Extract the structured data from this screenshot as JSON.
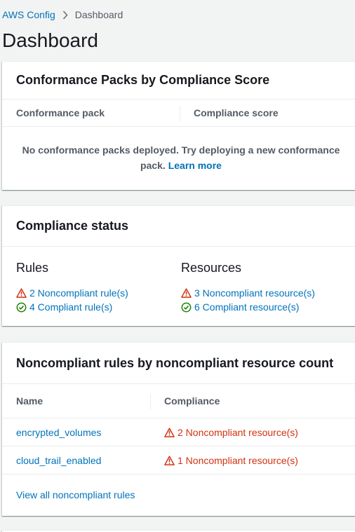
{
  "breadcrumb": {
    "root": "AWS Config",
    "current": "Dashboard"
  },
  "page_title": "Dashboard",
  "conformance": {
    "title": "Conformance Packs by Compliance Score",
    "col_pack": "Conformance pack",
    "col_score": "Compliance score",
    "empty_text": "No conformance packs deployed. Try deploying a new conformance pack.",
    "learn_more": "Learn more"
  },
  "compliance_status": {
    "title": "Compliance status",
    "rules": {
      "heading": "Rules",
      "noncompliant": "2 Noncompliant rule(s)",
      "compliant": "4 Compliant rule(s)"
    },
    "resources": {
      "heading": "Resources",
      "noncompliant": "3 Noncompliant resource(s)",
      "compliant": "6 Compliant resource(s)"
    }
  },
  "noncompliant_rules": {
    "title": "Noncompliant rules by noncompliant resource count",
    "col_name": "Name",
    "col_compliance": "Compliance",
    "rows": [
      {
        "name": "encrypted_volumes",
        "compliance": "2 Noncompliant resource(s)"
      },
      {
        "name": "cloud_trail_enabled",
        "compliance": "1 Noncompliant resource(s)"
      }
    ],
    "view_all": "View all noncompliant rules"
  },
  "colors": {
    "link": "#0073bb",
    "error": "#d13212",
    "success": "#1d8102",
    "background": "#f2f3f3"
  },
  "icons": {
    "warning": "warning-triangle-icon",
    "success": "check-circle-icon",
    "separator": "chevron-right-icon"
  }
}
